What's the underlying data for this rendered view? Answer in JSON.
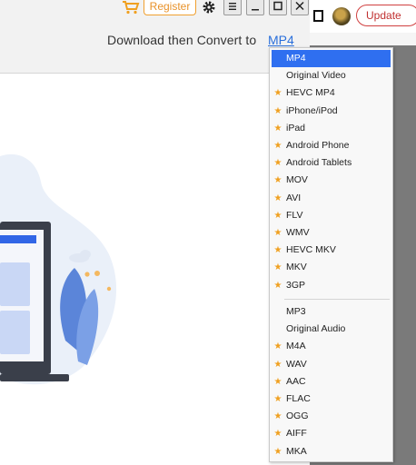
{
  "header": {
    "register_label": "Register",
    "download_label": "Download then Convert to",
    "format_link": "MP4"
  },
  "browser": {
    "update_label": "Update"
  },
  "dropdown": {
    "video_items": [
      {
        "label": "MP4",
        "star": false,
        "selected": true
      },
      {
        "label": "Original Video",
        "star": false
      },
      {
        "label": "HEVC MP4",
        "star": true
      },
      {
        "label": "iPhone/iPod",
        "star": true
      },
      {
        "label": "iPad",
        "star": true
      },
      {
        "label": "Android Phone",
        "star": true
      },
      {
        "label": "Android Tablets",
        "star": true
      },
      {
        "label": "MOV",
        "star": true
      },
      {
        "label": "AVI",
        "star": true
      },
      {
        "label": "FLV",
        "star": true
      },
      {
        "label": "WMV",
        "star": true
      },
      {
        "label": "HEVC MKV",
        "star": true
      },
      {
        "label": "MKV",
        "star": true
      },
      {
        "label": "3GP",
        "star": true
      }
    ],
    "audio_items": [
      {
        "label": "MP3",
        "star": false
      },
      {
        "label": "Original Audio",
        "star": false
      },
      {
        "label": "M4A",
        "star": true
      },
      {
        "label": "WAV",
        "star": true
      },
      {
        "label": "AAC",
        "star": true
      },
      {
        "label": "FLAC",
        "star": true
      },
      {
        "label": "OGG",
        "star": true
      },
      {
        "label": "AIFF",
        "star": true
      },
      {
        "label": "MKA",
        "star": true
      }
    ],
    "star_glyph": "★"
  },
  "colors": {
    "accent": "#2f6ff0",
    "star": "#f0a020",
    "register": "#e8922a",
    "update": "#c03030"
  },
  "icons": [
    "cart-icon",
    "gear-icon",
    "menu-icon",
    "minimize-icon",
    "maximize-icon",
    "close-icon",
    "star-icon"
  ]
}
